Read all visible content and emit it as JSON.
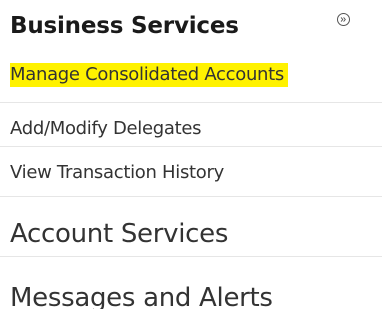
{
  "business_services": {
    "title": "Business Services",
    "toggle_icon": "collapse-circle-icon",
    "items": [
      {
        "label": "Manage Consolidated Accounts",
        "highlighted": true
      },
      {
        "label": "Add/Modify Delegates"
      },
      {
        "label": "View Transaction History"
      }
    ]
  },
  "main_nav": {
    "items": [
      {
        "label": "Account Services"
      },
      {
        "label": "Messages and Alerts"
      }
    ]
  },
  "colors": {
    "highlight": "#fff200",
    "text": "#333333",
    "title": "#1a1a1a"
  }
}
